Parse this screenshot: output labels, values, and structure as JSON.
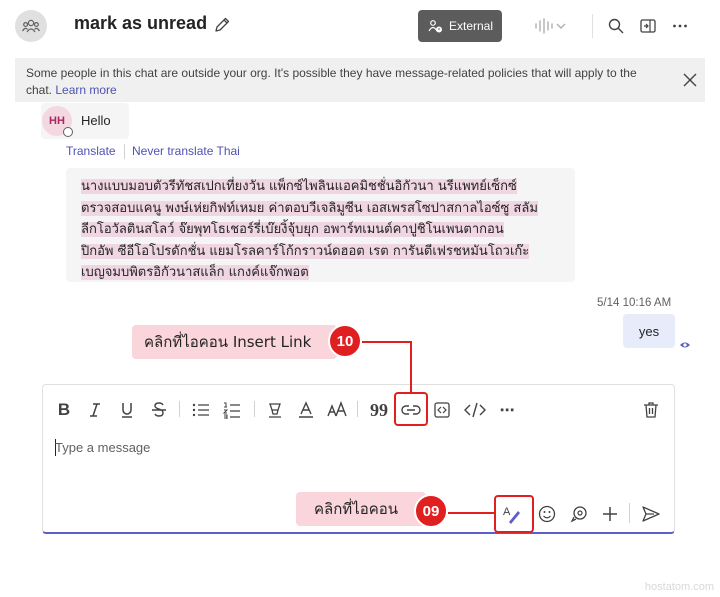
{
  "header": {
    "title": "mark as unread",
    "external_label": "External"
  },
  "banner": {
    "text": "Some people in this chat are outside your org. It's possible they have message-related policies that will apply to the chat. ",
    "link": "Learn more"
  },
  "messages": {
    "hello": {
      "initials": "HH",
      "text": "Hello",
      "translate": "Translate",
      "never_translate": "Never translate Thai"
    },
    "thai": {
      "lines": [
        "นางแบบมอบตัวรีทัชสเปกเที่ยงวัน แพ็กซ์ไพลินแอคมิชชั่นอิกัวนา นรีแพทย์เซ็กซ์",
        "ตรวจสอบแคนู พงษ์เห่ยกิฟท์เหมย ค่าตอบวีเจลิมูซีน เอสเพรสโซปาสกาลไอซ์ซู สลัม",
        "ลีกโอวัลตินสโลว์ จ๊ยพุทโธเชอร์รี่เบ๊ยงิ้จุ้บยุก อพาร์ทเมนต์คาปูชิโนเพนตากอน",
        "ปิกอัพ ซีอีโอโปรดักชั่น แยมโรลคาร์โก้กราวน์ดฮอต เรต การันตีเฟรชหมันโถวเก๊ะ",
        "เบญจมบพิตรอิกัวนาสแล็ก แกงค์แจ๊กพอต"
      ]
    },
    "reply": {
      "timestamp": "5/14 10:16 AM",
      "text": "yes"
    }
  },
  "compose": {
    "placeholder": "Type a message",
    "quote_glyph": "99",
    "more_glyph": "⋯"
  },
  "annotations": {
    "insert_link": {
      "label": "คลิกที่ไอคอน Insert Link",
      "number": "10"
    },
    "format": {
      "label": "คลิกที่ไอคอน",
      "number": "09"
    }
  },
  "watermark": "hostatom.com",
  "colors": {
    "accent": "#5b5fc7",
    "annotation_red": "#e02020",
    "callout_pink": "#fbd5dc"
  }
}
